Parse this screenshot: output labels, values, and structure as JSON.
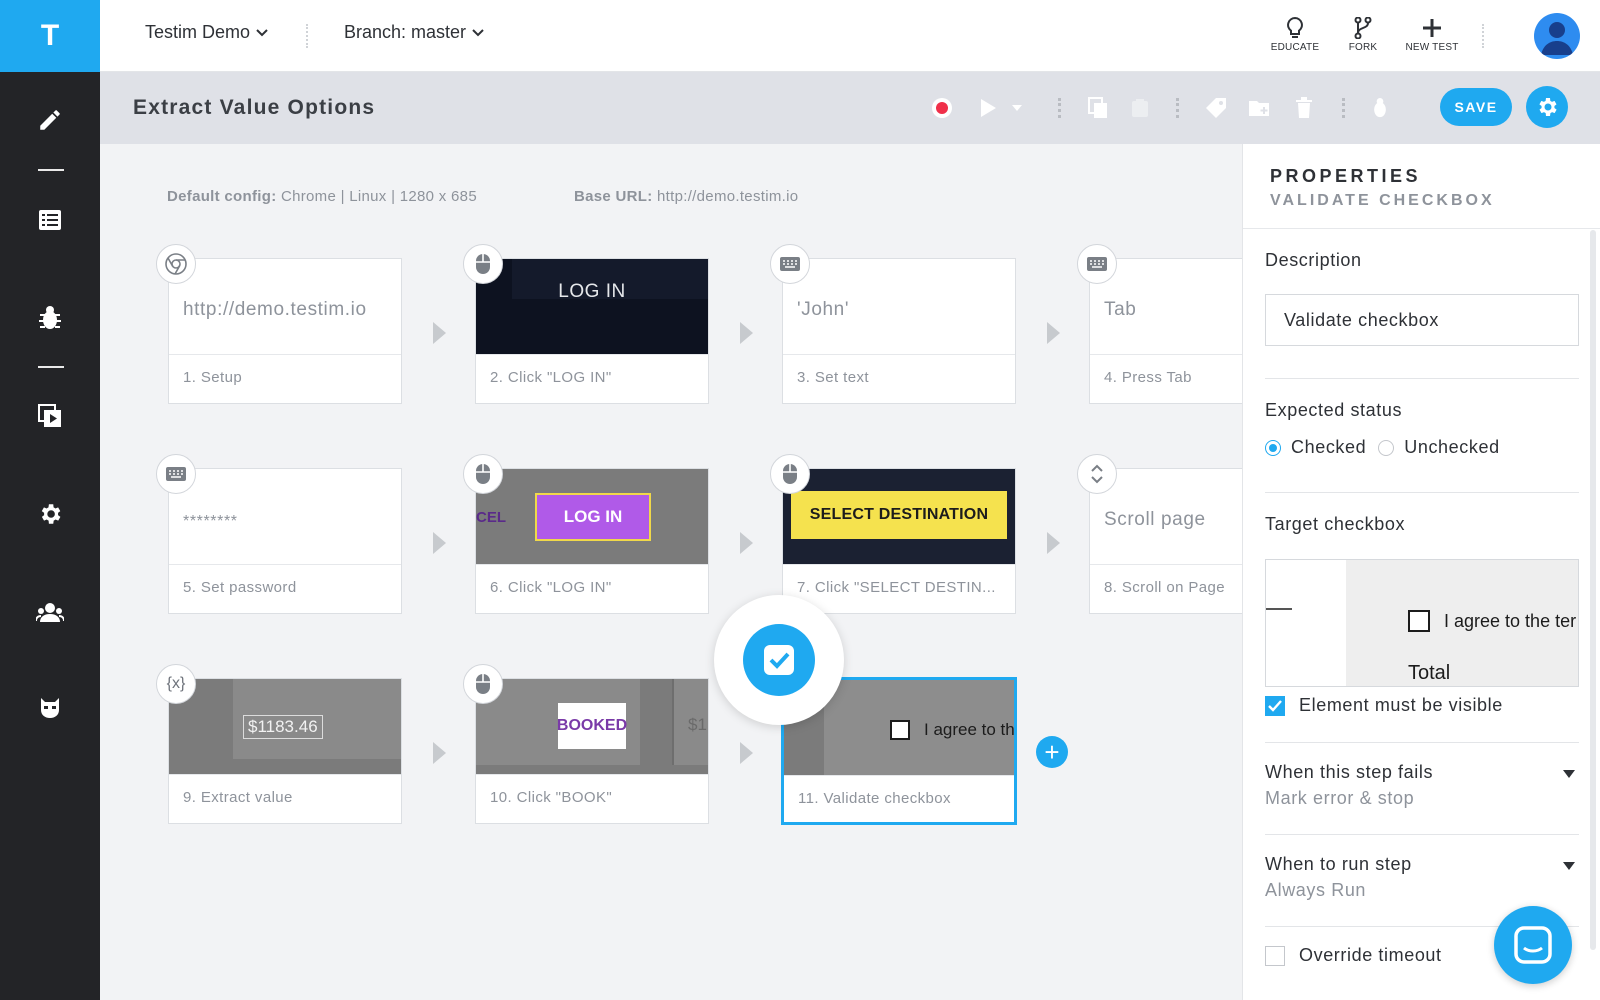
{
  "app": {
    "logo_letter": "T"
  },
  "header": {
    "project": "Testim Demo",
    "branch": "Branch: master",
    "actions": [
      {
        "label": "EDUCATE",
        "icon": "lightbulb-icon"
      },
      {
        "label": "FORK",
        "icon": "fork-icon"
      },
      {
        "label": "NEW TEST",
        "icon": "plus-icon"
      }
    ]
  },
  "titlebar": {
    "title": "Extract Value Options",
    "save_label": "SAVE"
  },
  "config": {
    "default_label": "Default config:",
    "default_value": "Chrome | Linux | 1280 x 685",
    "base_label": "Base URL:",
    "base_value": "http://demo.testim.io"
  },
  "steps": [
    {
      "label": "1. Setup",
      "thumb": "http://demo.testim.io",
      "badge": "chrome-icon"
    },
    {
      "label": "2. Click \"LOG IN\"",
      "thumb": "LOG IN",
      "badge": "mouse-icon"
    },
    {
      "label": "3. Set text",
      "thumb": "'John'",
      "badge": "keyboard-icon"
    },
    {
      "label": "4. Press Tab",
      "thumb": "Tab",
      "badge": "keyboard-icon"
    },
    {
      "label": "5. Set password",
      "thumb": "********",
      "badge": "keyboard-icon"
    },
    {
      "label": "6. Click \"LOG IN\"",
      "thumb": "LOG IN",
      "thumb_side": "CEL",
      "badge": "mouse-icon"
    },
    {
      "label": "7. Click \"SELECT DESTIN...",
      "thumb": "SELECT DESTINATION",
      "badge": "mouse-icon"
    },
    {
      "label": "8. Scroll on Page",
      "thumb": "Scroll page",
      "badge": "scroll-icon"
    },
    {
      "label": "9. Extract value",
      "thumb": "$1183.46",
      "badge": "variable-icon",
      "badge_text": "{x}"
    },
    {
      "label": "10. Click \"BOOK\"",
      "thumb": "BOOKED",
      "thumb_side": "$1",
      "badge": "mouse-icon"
    },
    {
      "label": "11. Validate checkbox",
      "thumb": "I agree to th",
      "badge": "checkbox-icon"
    }
  ],
  "properties": {
    "title": "PROPERTIES",
    "subtitle": "VALIDATE CHECKBOX",
    "description_label": "Description",
    "description_value": "Validate checkbox",
    "expected_label": "Expected status",
    "status_options": [
      "Checked",
      "Unchecked"
    ],
    "status_selected": "Checked",
    "target_label": "Target checkbox",
    "target_text": "I agree to the ter",
    "target_total": "Total",
    "visible_label": "Element must be visible",
    "visible_checked": true,
    "fails_label": "When this step fails",
    "fails_value": "Mark error & stop",
    "run_label": "When to run step",
    "run_value": "Always Run",
    "timeout_label": "Override timeout",
    "timeout_checked": false
  },
  "colors": {
    "accent": "#1fa9f0",
    "sidebar": "#232427",
    "record": "#f0304a"
  }
}
